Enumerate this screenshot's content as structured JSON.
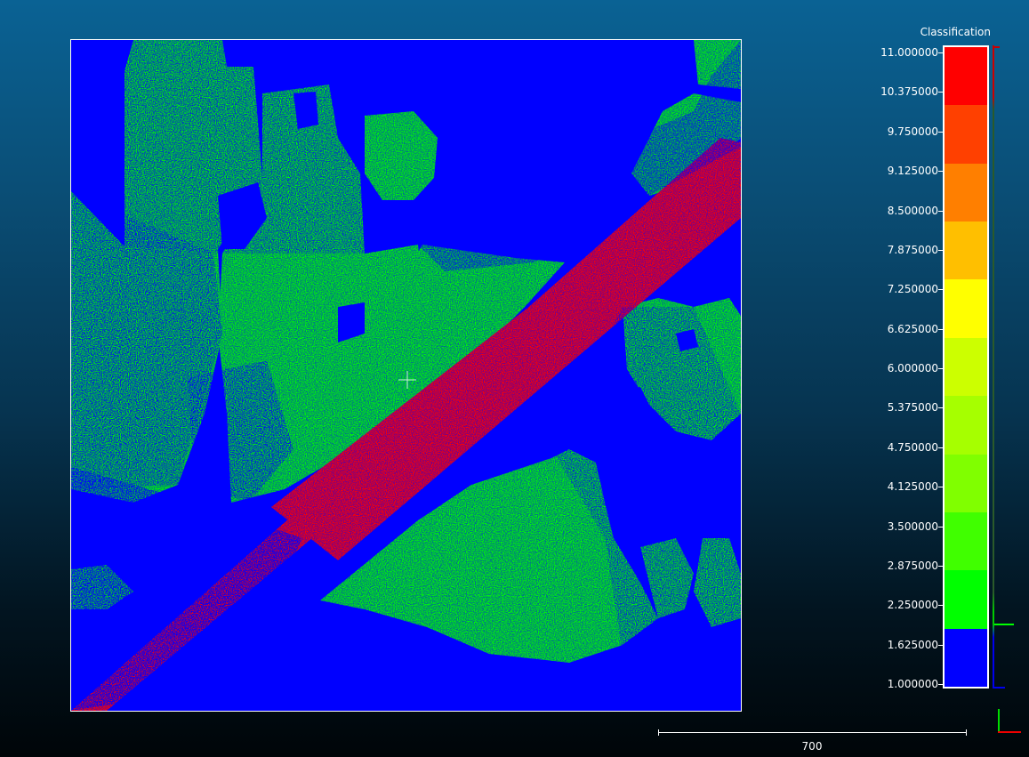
{
  "scale": {
    "title": "Classification",
    "labels": [
      "11.000000",
      "10.375000",
      "9.750000",
      "9.125000",
      "8.500000",
      "7.875000",
      "7.250000",
      "6.625000",
      "6.000000",
      "5.375000",
      "4.750000",
      "4.125000",
      "3.500000",
      "2.875000",
      "2.250000",
      "1.625000",
      "1.000000"
    ],
    "bands": [
      "#ff0000",
      "#ff4000",
      "#ff7f00",
      "#ffbf00",
      "#ffff00",
      "#ccff00",
      "#a6ff00",
      "#80ff00",
      "#40ff00",
      "#00ff00",
      "#0000ff"
    ],
    "band_weights": [
      1,
      1,
      1,
      1,
      1,
      1,
      1,
      1,
      1,
      1,
      1
    ]
  },
  "ruler": {
    "label": "700"
  },
  "colors": {
    "ground": "#00ff00",
    "unclassified": "#0000ff",
    "high": "#ff0000",
    "background_top": "#0a6294",
    "background_bottom": "#000508"
  },
  "icons": {
    "axis": "axis-trihedron-icon",
    "crosshair": "crosshair-icon"
  }
}
